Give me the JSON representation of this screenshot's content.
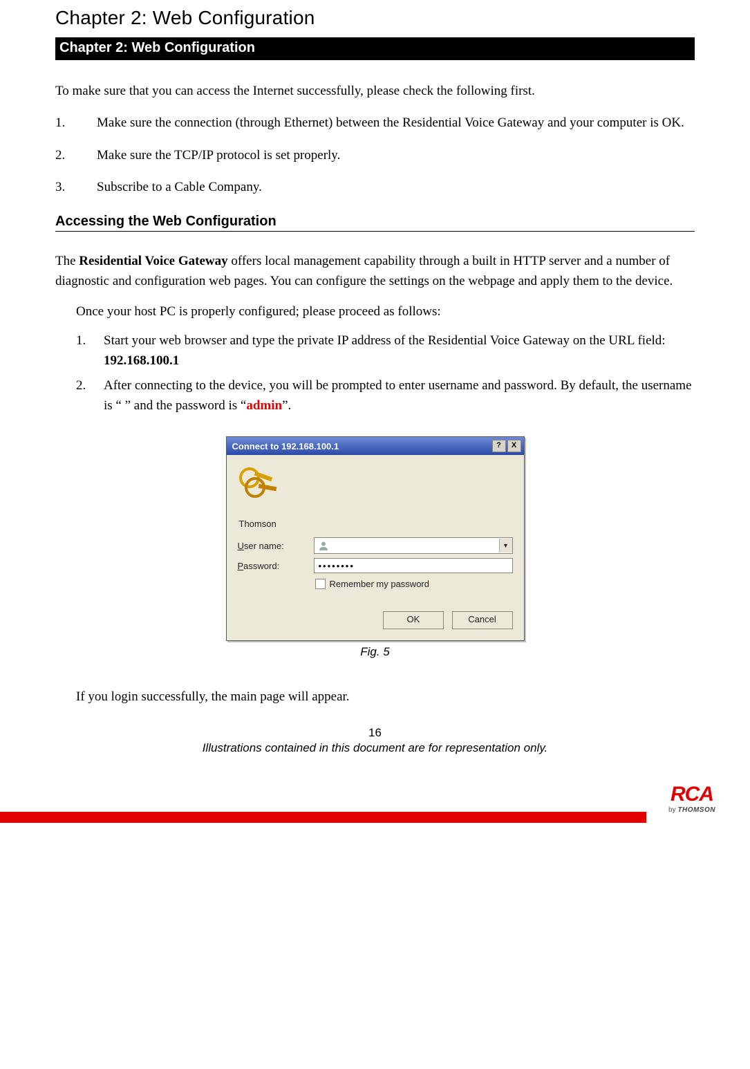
{
  "header": {
    "chapter_title": "Chapter 2: Web Configuration",
    "chapter_bar": "Chapter 2: Web Configuration"
  },
  "intro_text": "To make sure that you can access the Internet successfully, please check the following first.",
  "main_list": [
    "Make sure the connection (through Ethernet) between the Residential Voice Gateway and your computer is OK.",
    "Make sure the TCP/IP protocol is set properly.",
    "Subscribe to a Cable Company."
  ],
  "section_heading": "Accessing the Web Configuration",
  "section_para_prefix": "The ",
  "section_para_bold": "Residential Voice Gateway",
  "section_para_suffix": " offers local management capability through a built in HTTP server and a number of diagnostic and configuration web pages. You can configure the settings on the webpage and apply them to the device.",
  "proceed_text": "Once your host PC is properly configured; please proceed as follows:",
  "sub_list": {
    "item1_prefix": "Start your web browser and type the private IP address of the Residential Voice Gateway on the URL field: ",
    "item1_bold": "192.168.100.1",
    "item2_prefix": "After connecting to the device, you will be prompted to enter username and password. By default, the username is “ ” and the password is “",
    "item2_red": "admin",
    "item2_suffix": "”."
  },
  "dialog": {
    "title": "Connect to 192.168.100.1",
    "help_btn": "?",
    "close_btn": "X",
    "realm": "Thomson",
    "username_label_u": "U",
    "username_label_rest": "ser name:",
    "password_label_u": "P",
    "password_label_rest": "assword:",
    "password_value": "••••••••",
    "remember_u": "R",
    "remember_rest": "emember my password",
    "ok_label": "OK",
    "cancel_label": "Cancel"
  },
  "fig_caption": "Fig. 5",
  "login_success_text": "If you login successfully, the main page will appear.",
  "page_number": "16",
  "footer_note": "Illustrations contained in this document are for representation only.",
  "logo": {
    "brand": "RCA",
    "by": "by ",
    "maker": "THOMSON"
  }
}
